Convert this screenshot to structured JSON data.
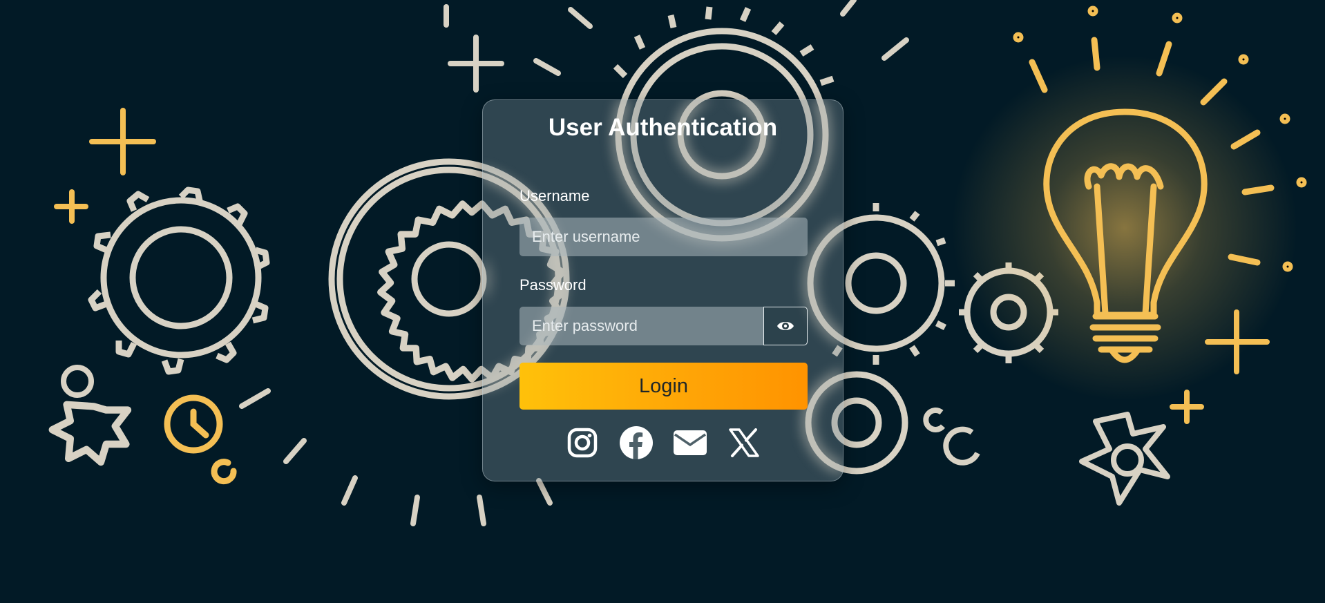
{
  "page": {
    "background_color": "#021a26",
    "art_color": "#d8d2c4",
    "accent_color": "#f4bf54"
  },
  "form": {
    "title": "User Authentication",
    "username": {
      "label": "Username",
      "placeholder": "Enter username",
      "value": ""
    },
    "password": {
      "label": "Password",
      "placeholder": "Enter password",
      "value": "",
      "toggle_icon": "eye-icon"
    },
    "login_label": "Login",
    "login_gradient": [
      "#ffc10a",
      "#ff9300"
    ]
  },
  "socials": [
    {
      "icon": "instagram-icon"
    },
    {
      "icon": "facebook-icon"
    },
    {
      "icon": "envelope-icon"
    },
    {
      "icon": "x-icon"
    }
  ]
}
